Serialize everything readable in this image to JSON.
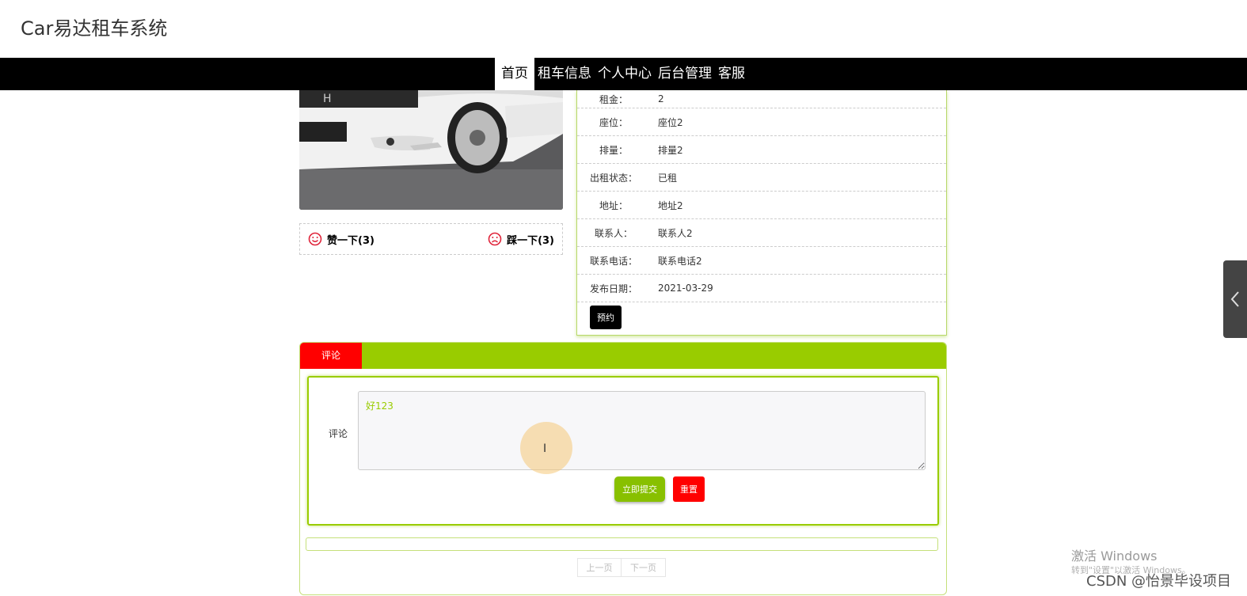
{
  "site": {
    "title": "Car易达租车系统"
  },
  "nav": {
    "items": [
      {
        "label": "首页",
        "active": true
      },
      {
        "label": "租车信息"
      },
      {
        "label": "个人中心"
      },
      {
        "label": "后台管理"
      },
      {
        "label": "客服"
      }
    ]
  },
  "vote": {
    "like_label": "赞一下(3)",
    "dislike_label": "踩一下(3)"
  },
  "details": {
    "rows": [
      {
        "label": "租金：",
        "value": "2"
      },
      {
        "label": "座位：",
        "value": "座位2"
      },
      {
        "label": "排量：",
        "value": "排量2"
      },
      {
        "label": "出租状态：",
        "value": "已租"
      },
      {
        "label": "地址：",
        "value": "地址2"
      },
      {
        "label": "联系人：",
        "value": "联系人2"
      },
      {
        "label": "联系电话：",
        "value": "联系电话2"
      },
      {
        "label": "发布日期：",
        "value": "2021-03-29"
      }
    ],
    "reserve_label": "预约"
  },
  "comments": {
    "tab_label": "评论",
    "field_label": "评论",
    "input_value": "好123",
    "submit_label": "立即提交",
    "reset_label": "重置",
    "prev_label": "上一页",
    "next_label": "下一页"
  },
  "watermark": {
    "activate_title": "激活 Windows",
    "activate_sub": "转到\"设置\"以激活 Windows。",
    "csdn": "CSDN @怡景毕设项目"
  },
  "colors": {
    "accent": "#99cc00",
    "danger": "#ff0000",
    "nav_bg": "#000000"
  }
}
